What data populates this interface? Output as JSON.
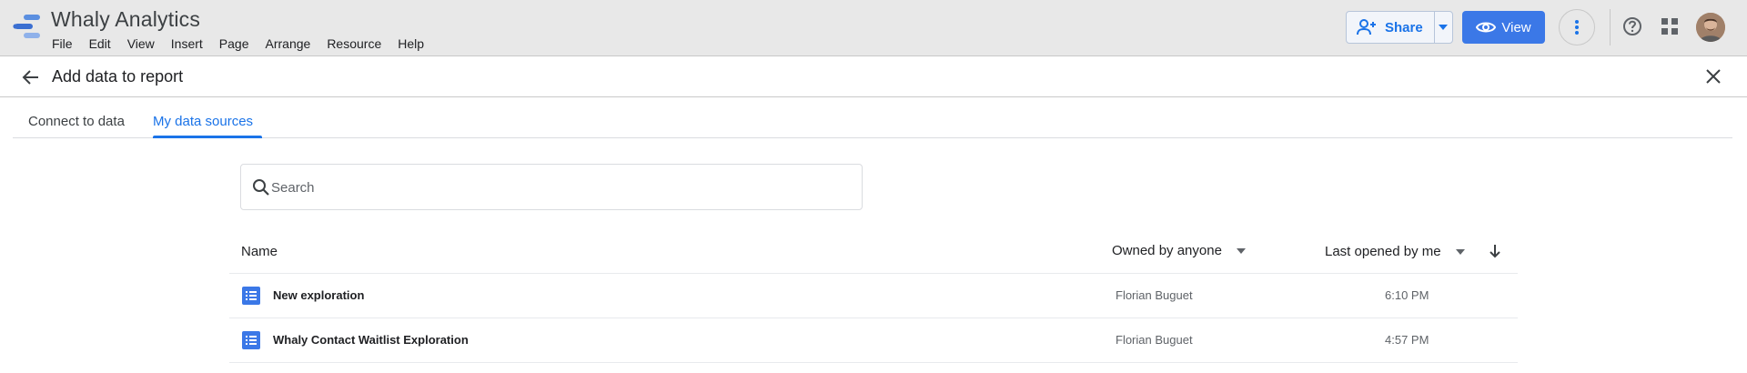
{
  "app": {
    "title": "Whaly Analytics",
    "logo_icon": "data-studio-logo-icon",
    "accent_color": "#1a73e8"
  },
  "menu": [
    "File",
    "Edit",
    "View",
    "Insert",
    "Page",
    "Arrange",
    "Resource",
    "Help"
  ],
  "toolbar": {
    "share_label": "Share",
    "view_label": "View"
  },
  "panel": {
    "title": "Add data to report"
  },
  "tabs": [
    {
      "label": "Connect to data",
      "active": false
    },
    {
      "label": "My data sources",
      "active": true
    }
  ],
  "search": {
    "placeholder": "Search",
    "value": ""
  },
  "table": {
    "columns": {
      "name": "Name",
      "owner": "Owned by anyone",
      "opened": "Last opened by me"
    },
    "rows": [
      {
        "name": "New exploration",
        "owner": "Florian Buguet",
        "time": "6:10 PM",
        "icon": "data-source-icon"
      },
      {
        "name": "Whaly Contact Waitlist Exploration",
        "owner": "Florian Buguet",
        "time": "4:57 PM",
        "icon": "data-source-icon"
      }
    ]
  }
}
